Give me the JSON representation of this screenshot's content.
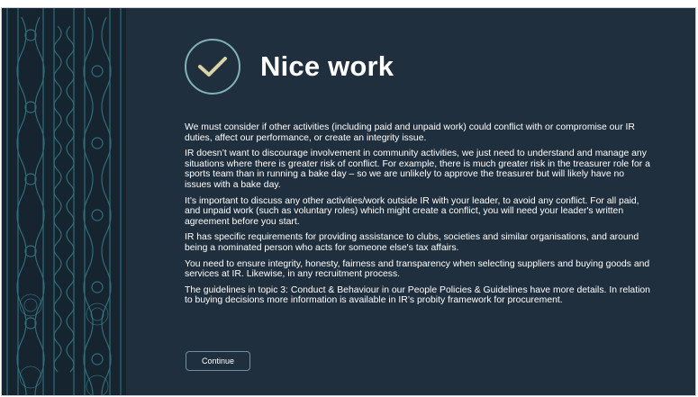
{
  "header": {
    "title": "Nice work",
    "icon": "checkmark-icon"
  },
  "paragraphs": [
    "We must consider if other activities (including paid and unpaid work) could conflict with or compromise our IR duties, affect our performance, or create an integrity issue.",
    "IR doesn’t want to discourage involvement in community activities, we just need to understand and manage any situations where there is greater risk of conflict.  For example, there is much greater risk in the treasurer role for a sports team than in running a bake day – so we are unlikely to approve the treasurer but will likely have no issues with a bake day.",
    "It’s important to discuss any other activities/work outside IR with your leader, to avoid any conflict. For all paid, and unpaid work (such as voluntary roles) which might create a conflict, you will need your leader's written agreement before you start.",
    "IR has specific requirements for providing assistance to clubs, societies and similar organisations, and around being a nominated person who acts for someone else's tax affairs.",
    "You need to ensure integrity, honesty, fairness and transparency when selecting suppliers and buying goods and services at IR.  Likewise, in any recruitment process.",
    "The guidelines in topic 3: Conduct & Behaviour in our People Policies & Guidelines have more details. In relation to buying decisions more information is available in IR’s probity framework for procurement."
  ],
  "actions": {
    "continue_label": "Continue"
  },
  "colors": {
    "background": "#1f2f3d",
    "pattern": "#162430",
    "accent_teal": "#7fb3b8",
    "check": "#d9d3a6",
    "text": "#ffffff"
  }
}
